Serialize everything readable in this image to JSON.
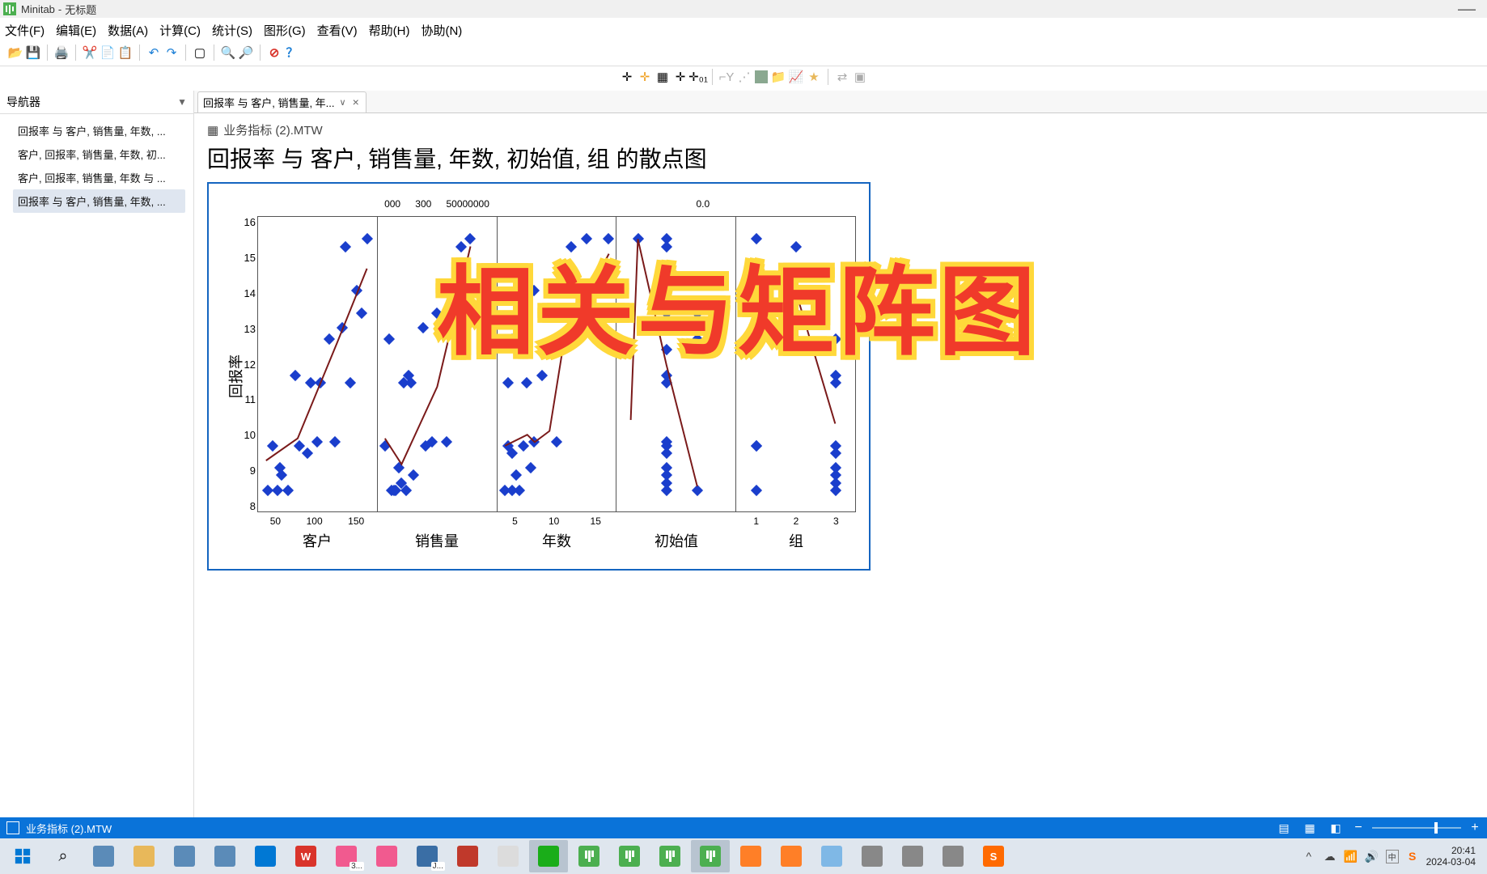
{
  "window": {
    "app": "Minitab",
    "sep": " - ",
    "doc": "无标题"
  },
  "menus": [
    "文件(F)",
    "编辑(E)",
    "数据(A)",
    "计算(C)",
    "统计(S)",
    "图形(G)",
    "查看(V)",
    "帮助(H)",
    "协助(N)"
  ],
  "nav": {
    "title": "导航器",
    "items": [
      "回报率 与 客户, 销售量, 年数, ...",
      "客户, 回报率, 销售量, 年数, 初...",
      "客户, 回报率, 销售量, 年数 与 ...",
      "回报率 与 客户, 销售量, 年数, ..."
    ],
    "selected": 3
  },
  "tab": {
    "label": "回报率 与 客户, 销售量, 年..."
  },
  "file": {
    "name": "业务指标 (2).MTW"
  },
  "chart_title": "回报率 与 客户, 销售量, 年数, 初始值, 组 的散点图",
  "overlay": "相关与矩阵图",
  "chart_data": {
    "type": "scatter",
    "ylabel": "回报率",
    "ylim": [
      8,
      16
    ],
    "yticks": [
      8,
      9,
      10,
      11,
      12,
      13,
      14,
      15,
      16
    ],
    "panels": [
      {
        "name": "客户",
        "xticks": [
          "50",
          "100",
          "150"
        ],
        "xrange": [
          40,
          160
        ],
        "points": [
          [
            50,
            8.6
          ],
          [
            55,
            9.8
          ],
          [
            60,
            8.6
          ],
          [
            62,
            9.2
          ],
          [
            64,
            9.0
          ],
          [
            70,
            8.6
          ],
          [
            78,
            11.7
          ],
          [
            82,
            9.8
          ],
          [
            90,
            9.6
          ],
          [
            93,
            11.5
          ],
          [
            100,
            9.9
          ],
          [
            103,
            11.5
          ],
          [
            112,
            12.7
          ],
          [
            118,
            9.9
          ],
          [
            125,
            13.0
          ],
          [
            128,
            15.2
          ],
          [
            133,
            11.5
          ],
          [
            140,
            14.0
          ],
          [
            145,
            13.4
          ],
          [
            150,
            15.4
          ]
        ],
        "line": [
          [
            48,
            9.4
          ],
          [
            80,
            10.0
          ],
          [
            120,
            12.6
          ],
          [
            150,
            14.6
          ]
        ]
      },
      {
        "name": "销售量",
        "xticks": [
          "000",
          "300",
          "50000000"
        ],
        "xrange": [
          0,
          100
        ],
        "points": [
          [
            6,
            9.8
          ],
          [
            10,
            12.7
          ],
          [
            12,
            8.6
          ],
          [
            14,
            8.6
          ],
          [
            15,
            8.6
          ],
          [
            18,
            9.2
          ],
          [
            20,
            8.8
          ],
          [
            22,
            11.5
          ],
          [
            24,
            8.6
          ],
          [
            26,
            11.7
          ],
          [
            28,
            11.5
          ],
          [
            30,
            9.0
          ],
          [
            38,
            13.0
          ],
          [
            40,
            9.8
          ],
          [
            46,
            9.9
          ],
          [
            50,
            13.4
          ],
          [
            54,
            14.0
          ],
          [
            58,
            9.9
          ],
          [
            70,
            15.2
          ],
          [
            78,
            15.4
          ]
        ],
        "line": [
          [
            6,
            10.0
          ],
          [
            20,
            9.3
          ],
          [
            50,
            11.4
          ],
          [
            78,
            15.2
          ]
        ]
      },
      {
        "name": "年数",
        "xticks": [
          "5",
          "10",
          "15"
        ],
        "xrange": [
          3,
          19
        ],
        "points": [
          [
            4,
            8.6
          ],
          [
            4.5,
            9.8
          ],
          [
            4.5,
            11.5
          ],
          [
            5,
            9.6
          ],
          [
            5,
            8.6
          ],
          [
            5,
            12.7
          ],
          [
            5.5,
            9.0
          ],
          [
            6,
            8.6
          ],
          [
            6.5,
            9.8
          ],
          [
            7,
            13.0
          ],
          [
            7,
            11.5
          ],
          [
            7.5,
            9.2
          ],
          [
            8,
            14.0
          ],
          [
            8,
            9.9
          ],
          [
            9,
            11.7
          ],
          [
            10,
            12.4
          ],
          [
            11,
            9.9
          ],
          [
            12,
            13.4
          ],
          [
            13,
            15.2
          ],
          [
            15,
            15.4
          ],
          [
            18,
            15.4
          ]
        ],
        "line": [
          [
            4,
            9.8
          ],
          [
            7,
            10.1
          ],
          [
            8,
            9.9
          ],
          [
            10,
            10.2
          ],
          [
            12,
            12.7
          ],
          [
            18,
            15.0
          ]
        ]
      },
      {
        "name": "初始值",
        "xticks": [
          "",
          "0.0"
        ],
        "xrange": [
          0,
          100
        ],
        "points": [
          [
            18,
            15.4
          ],
          [
            42,
            8.6
          ],
          [
            42,
            8.8
          ],
          [
            42,
            9.0
          ],
          [
            42,
            9.2
          ],
          [
            42,
            9.6
          ],
          [
            42,
            9.8
          ],
          [
            42,
            9.9
          ],
          [
            42,
            11.5
          ],
          [
            42,
            11.7
          ],
          [
            42,
            12.4
          ],
          [
            42,
            13.0
          ],
          [
            42,
            13.4
          ],
          [
            42,
            14.0
          ],
          [
            42,
            15.2
          ],
          [
            42,
            15.4
          ],
          [
            68,
            8.6
          ],
          [
            68,
            12.7
          ],
          [
            68,
            13.4
          ]
        ],
        "line": [
          [
            12,
            10.5
          ],
          [
            18,
            15.4
          ],
          [
            42,
            12.0
          ],
          [
            68,
            8.7
          ]
        ]
      },
      {
        "name": "组",
        "xticks": [
          "1",
          "2",
          "3"
        ],
        "xrange": [
          0.5,
          3.5
        ],
        "points": [
          [
            1,
            8.6
          ],
          [
            1,
            9.8
          ],
          [
            1,
            9.8
          ],
          [
            1,
            15.4
          ],
          [
            2,
            12.7
          ],
          [
            2,
            13.4
          ],
          [
            2,
            15.2
          ],
          [
            3,
            8.6
          ],
          [
            3,
            8.8
          ],
          [
            3,
            9.0
          ],
          [
            3,
            9.2
          ],
          [
            3,
            9.6
          ],
          [
            3,
            9.8
          ],
          [
            3,
            11.5
          ],
          [
            3,
            11.7
          ],
          [
            3,
            12.7
          ]
        ],
        "line": [
          [
            1,
            14.4
          ],
          [
            2,
            14.0
          ],
          [
            3,
            10.4
          ]
        ]
      }
    ]
  },
  "statusbar": {
    "file": "业务指标 (2).MTW"
  },
  "taskbar": {
    "apps": [
      {
        "name": "start",
        "color": "#0078d4"
      },
      {
        "name": "search",
        "color": "#333"
      },
      {
        "name": "taskview",
        "color": "#5b8bb8"
      },
      {
        "name": "explorer",
        "color": "#e8b85a"
      },
      {
        "name": "explorer2",
        "color": "#5b8bb8"
      },
      {
        "name": "people",
        "color": "#5b8bb8"
      },
      {
        "name": "edge",
        "color": "#0078d4"
      },
      {
        "name": "wps",
        "color": "#d9342b",
        "label": "W"
      },
      {
        "name": "bili",
        "color": "#f15a8f",
        "badge": "3..."
      },
      {
        "name": "bili2",
        "color": "#f15a8f"
      },
      {
        "name": "jmp",
        "color": "#3a6ea5",
        "badge": "J..."
      },
      {
        "name": "spss",
        "color": "#c0392b"
      },
      {
        "name": "excel",
        "color": "#dcdcdc"
      },
      {
        "name": "wechat",
        "color": "#1aad19",
        "active": true
      },
      {
        "name": "minitab1",
        "color": "#4caf50"
      },
      {
        "name": "minitab2",
        "color": "#4caf50"
      },
      {
        "name": "minitab3",
        "color": "#4caf50"
      },
      {
        "name": "minitab4",
        "color": "#4caf50",
        "active": true
      },
      {
        "name": "snip1",
        "color": "#ff7f27"
      },
      {
        "name": "snip2",
        "color": "#ff7f27"
      },
      {
        "name": "paint",
        "color": "#7fb8e6"
      },
      {
        "name": "app1",
        "color": "#888"
      },
      {
        "name": "app2",
        "color": "#888"
      },
      {
        "name": "app3",
        "color": "#888"
      },
      {
        "name": "sogou",
        "color": "#ff6a00",
        "label": "S"
      }
    ],
    "tray_ime": "中",
    "time": "20:41",
    "date": "2024-03-04"
  }
}
